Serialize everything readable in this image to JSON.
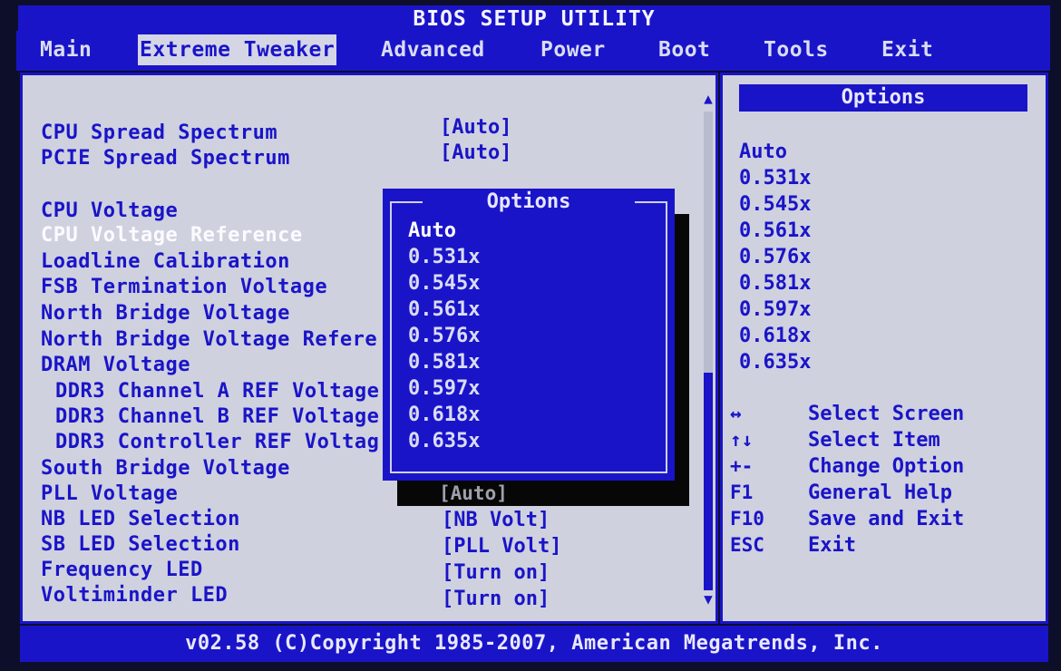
{
  "title": "BIOS SETUP UTILITY",
  "menu": [
    {
      "label": "Main",
      "active": false
    },
    {
      "label": "Extreme Tweaker",
      "active": true
    },
    {
      "label": "Advanced",
      "active": false
    },
    {
      "label": "Power",
      "active": false
    },
    {
      "label": "Boot",
      "active": false
    },
    {
      "label": "Tools",
      "active": false
    },
    {
      "label": "Exit",
      "active": false
    }
  ],
  "settings": [
    {
      "label": "CPU Spread Spectrum",
      "value": "[Auto]"
    },
    {
      "label": "PCIE Spread Spectrum",
      "value": "[Auto]"
    },
    {
      "label": "CPU Voltage",
      "value": ""
    },
    {
      "label": "CPU Voltage Reference",
      "value": "",
      "selected": true
    },
    {
      "label": "Loadline Calibration",
      "value": ""
    },
    {
      "label": "FSB Termination Voltage",
      "value": ""
    },
    {
      "label": "North Bridge Voltage",
      "value": ""
    },
    {
      "label": "North Bridge Voltage Refere",
      "value": ""
    },
    {
      "label": "DRAM Voltage",
      "value": ""
    },
    {
      "label": "DDR3 Channel A REF Voltage",
      "value": "",
      "sub": true
    },
    {
      "label": "DDR3 Channel B REF Voltage",
      "value": "",
      "sub": true
    },
    {
      "label": "DDR3 Controller REF Voltag",
      "value": "",
      "sub": true
    },
    {
      "label": "South Bridge Voltage",
      "value": ""
    },
    {
      "label": "PLL Voltage",
      "value": ""
    },
    {
      "label": "NB LED Selection",
      "value": "[NB Volt]"
    },
    {
      "label": "SB LED Selection",
      "value": "[PLL Volt]"
    },
    {
      "label": "Frequency LED",
      "value": "[Turn on]"
    },
    {
      "label": "Voltiminder LED",
      "value": "[Turn on]"
    }
  ],
  "popup": {
    "title": "Options",
    "options": [
      "Auto",
      "0.531x",
      "0.545x",
      "0.561x",
      "0.576x",
      "0.581x",
      "0.597x",
      "0.618x",
      "0.635x"
    ],
    "selected_index": 0,
    "background_value": "[Auto]"
  },
  "side_panel": {
    "header": "Options",
    "options": [
      "Auto",
      "0.531x",
      "0.545x",
      "0.561x",
      "0.576x",
      "0.581x",
      "0.597x",
      "0.618x",
      "0.635x"
    ],
    "keys": [
      {
        "key": "↔",
        "desc": "Select Screen"
      },
      {
        "key": "↑↓",
        "desc": "Select Item"
      },
      {
        "key": "+-",
        "desc": "Change Option"
      },
      {
        "key": "F1",
        "desc": "General Help"
      },
      {
        "key": "F10",
        "desc": "Save and Exit"
      },
      {
        "key": "ESC",
        "desc": "Exit"
      }
    ]
  },
  "footer": "v02.58 (C)Copyright 1985-2007, American Megatrends, Inc.",
  "colors": {
    "bios_blue": "#1a14c8",
    "panel_gray": "#cfd1df",
    "highlight_white": "#fbfbff"
  }
}
